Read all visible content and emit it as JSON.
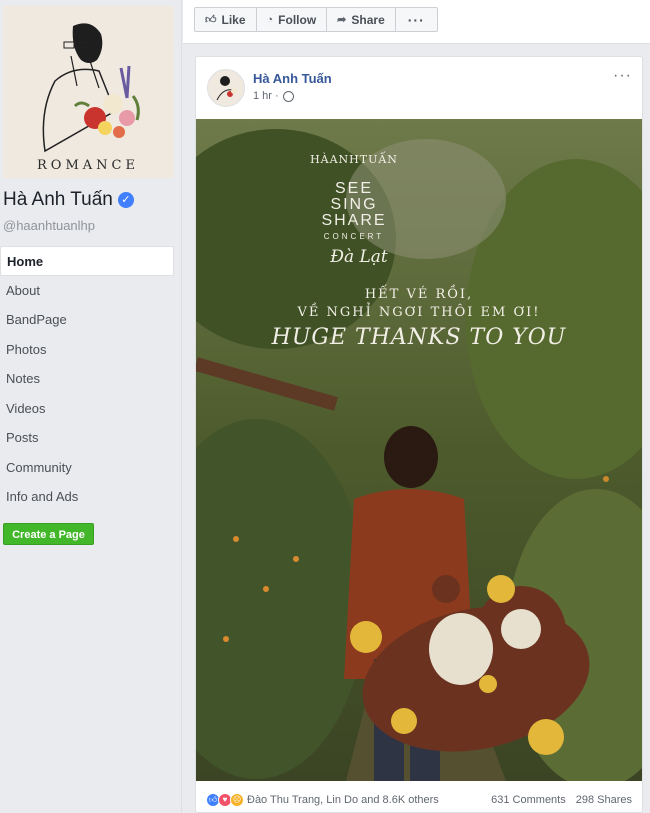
{
  "sidebar": {
    "cover_text": "ROMANCE",
    "page_name": "Hà Anh Tuấn",
    "handle": "@haanhtuanlhp",
    "nav": [
      "Home",
      "About",
      "BandPage",
      "Photos",
      "Notes",
      "Videos",
      "Posts",
      "Community",
      "Info and Ads"
    ],
    "create_page": "Create a Page"
  },
  "topbar": {
    "like": "Like",
    "follow": "Follow",
    "share": "Share",
    "more": "···"
  },
  "post": {
    "author": "Hà Anh Tuấn",
    "time": "1 hr ·",
    "menu": "···",
    "image_text": {
      "brand": "HÀANHTUẤN",
      "see": "SEE",
      "sing": "SING",
      "share": "SHARE",
      "concert": "CONCERT",
      "dalat": "Đà Lạt",
      "headline1": "HẾT VÉ RỒI,",
      "headline2": "VỀ NGHỈ NGƠI THÔI EM ƠI!",
      "thanks": "HUGE THANKS TO YOU"
    },
    "reactions": "Đào Thu Trang, Lin Do and 8.6K others",
    "comments": "631 Comments",
    "shares": "298 Shares"
  },
  "colors": {
    "link": "#365899",
    "create_btn": "#42b72a",
    "like_icon": "#4080ff"
  }
}
